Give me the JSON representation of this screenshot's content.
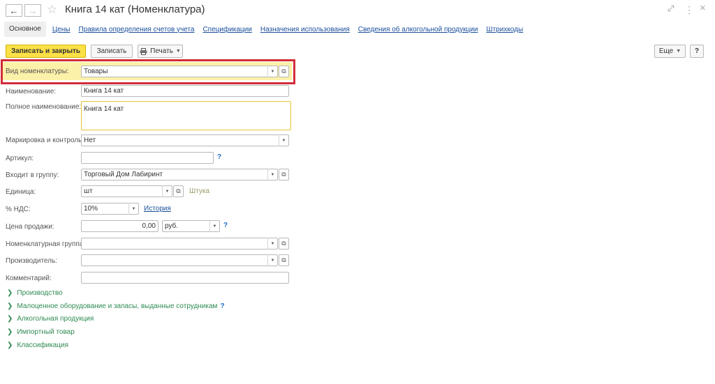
{
  "window": {
    "title": "Книга 14 кат (Номенклатура)",
    "back_icon": "←",
    "forward_icon": "→",
    "star_icon": "☆",
    "link_icon": "🔗",
    "more_icon": "⋮",
    "close_icon": "×"
  },
  "tabs": [
    {
      "label": "Основное"
    },
    {
      "label": "Цены"
    },
    {
      "label": "Правила определения счетов учета"
    },
    {
      "label": "Спецификации"
    },
    {
      "label": "Назначения использования"
    },
    {
      "label": "Сведения об алкогольной продукции"
    },
    {
      "label": "Штрихкоды"
    }
  ],
  "toolbar": {
    "save_close": "Записать и закрыть",
    "save": "Записать",
    "print": "Печать",
    "more": "Еще",
    "help": "?"
  },
  "form": {
    "kind": {
      "label": "Вид номенклатуры:",
      "value": "Товары"
    },
    "name": {
      "label": "Наименование:",
      "value": "Книга 14 кат"
    },
    "full_name": {
      "label": "Полное наименование:",
      "value": "Книга 14 кат"
    },
    "marking": {
      "label": "Маркировка и контроль:",
      "value": "Нет"
    },
    "article": {
      "label": "Артикул:",
      "value": "",
      "help": "?"
    },
    "group": {
      "label": "Входит в группу:",
      "value": "Торговый Дом Лабиринт"
    },
    "unit": {
      "label": "Единица:",
      "value": "шт",
      "hint": "Штука"
    },
    "vat": {
      "label": "% НДС:",
      "value": "10%",
      "link": "История"
    },
    "price": {
      "label": "Цена продажи:",
      "value": "0,00",
      "currency": "руб.",
      "help": "?"
    },
    "nom_group": {
      "label": "Номенклатурная группа:",
      "value": ""
    },
    "producer": {
      "label": "Производитель:",
      "value": ""
    },
    "comment": {
      "label": "Комментарий:",
      "value": ""
    }
  },
  "groups": [
    {
      "label": "Производство"
    },
    {
      "label": "Малоценное оборудование и запасы, выданные сотрудникам",
      "help": "?"
    },
    {
      "label": "Алкогольная продукция"
    },
    {
      "label": "Импортный товар"
    },
    {
      "label": "Классификация"
    }
  ]
}
